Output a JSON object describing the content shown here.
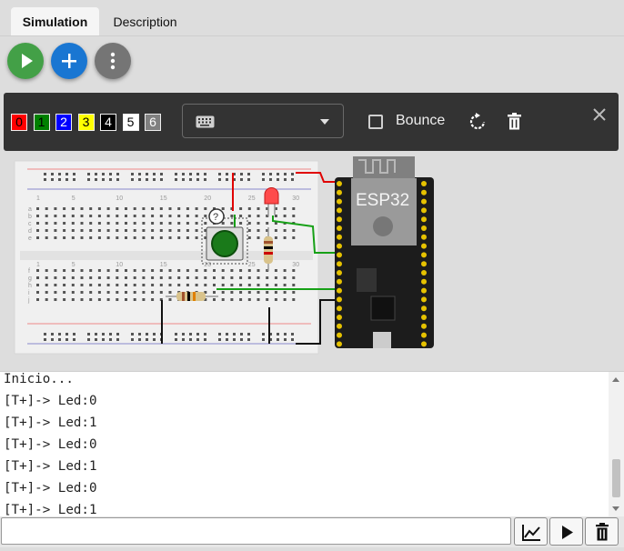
{
  "tabs": [
    {
      "label": "Simulation",
      "active": true
    },
    {
      "label": "Description",
      "active": false
    }
  ],
  "fab": {
    "play": {
      "icon": "play-icon",
      "color": "#43a047"
    },
    "add": {
      "icon": "plus-icon",
      "color": "#1976d2"
    },
    "menu": {
      "icon": "more-vert-icon",
      "color": "#757575"
    }
  },
  "wire_colors": [
    {
      "label": "0",
      "bg": "#ff0000",
      "fg": "#000000"
    },
    {
      "label": "1",
      "bg": "#008000",
      "fg": "#000000"
    },
    {
      "label": "2",
      "bg": "#0000ff",
      "fg": "#ffffff"
    },
    {
      "label": "3",
      "bg": "#ffff00",
      "fg": "#000000"
    },
    {
      "label": "4",
      "bg": "#000000",
      "fg": "#ffffff"
    },
    {
      "label": "5",
      "bg": "#ffffff",
      "fg": "#000000"
    },
    {
      "label": "6",
      "bg": "#808080",
      "fg": "#ffffff"
    }
  ],
  "toolbar": {
    "keyboard_select": {
      "icon": "keyboard-icon",
      "value": ""
    },
    "bounce_label": "Bounce",
    "bounce_checked": false,
    "rotate_icon": "rotate-icon",
    "delete_icon": "trash-icon",
    "close_icon": "close-icon"
  },
  "board": {
    "label": "ESP32",
    "breadboard_numbers": [
      "1",
      "5",
      "10",
      "15",
      "20",
      "25",
      "30"
    ],
    "row_letters_top": [
      "a",
      "b",
      "c",
      "d",
      "e"
    ],
    "row_letters_bottom": [
      "f",
      "g",
      "h",
      "i",
      "j"
    ]
  },
  "console": {
    "lines": [
      "Inicio...",
      "[T+]-> Led:0",
      "[T+]-> Led:1",
      "[T+]-> Led:0",
      "[T+]-> Led:1",
      "[T+]-> Led:0",
      "[T+]-> Led:1"
    ]
  },
  "serial_input": {
    "value": "",
    "placeholder": ""
  },
  "serial_buttons": {
    "plot_icon": "chart-icon",
    "send_icon": "play-icon",
    "clear_icon": "trash-icon"
  }
}
